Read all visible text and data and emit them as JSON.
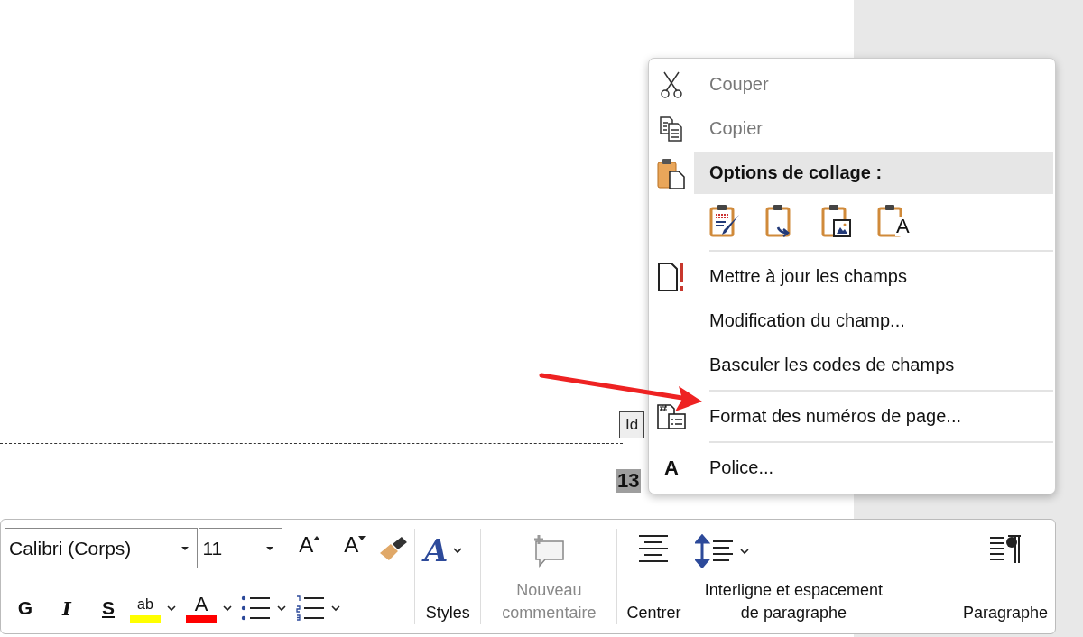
{
  "document": {
    "tab_label": "Id",
    "page_number": "13"
  },
  "context_menu": {
    "items": [
      {
        "kind": "command",
        "label": "Couper",
        "disabled": true,
        "highlighted": false
      },
      {
        "kind": "command",
        "label": "Copier",
        "disabled": true,
        "highlighted": false
      },
      {
        "kind": "header",
        "label": "Options de collage :",
        "highlighted": true
      },
      {
        "kind": "paste_options",
        "options": [
          {
            "kind": "keep_source"
          },
          {
            "kind": "merge"
          },
          {
            "kind": "picture"
          },
          {
            "kind": "text_only",
            "glyph": "A"
          }
        ]
      },
      {
        "kind": "separator"
      },
      {
        "kind": "command",
        "label": "Mettre à jour les champs",
        "disabled": false,
        "highlighted": false
      },
      {
        "kind": "command",
        "label": "Modification du champ...",
        "disabled": false,
        "highlighted": false
      },
      {
        "kind": "command",
        "label": "Basculer les codes de champs",
        "disabled": false,
        "highlighted": false
      },
      {
        "kind": "separator"
      },
      {
        "kind": "command",
        "label": "Format des numéros de page...",
        "disabled": false,
        "highlighted": false
      },
      {
        "kind": "separator"
      },
      {
        "kind": "command",
        "label": "Police...",
        "icon_glyph": "A",
        "disabled": false,
        "highlighted": false
      }
    ]
  },
  "mini_toolbar": {
    "font_field": {
      "value": "Calibri (Corps)"
    },
    "size_field": {
      "value": "11"
    },
    "font_size_buttons": [
      {
        "glyph": "A"
      },
      {
        "glyph": "A"
      }
    ],
    "format_buttons": [
      {
        "label": "G"
      },
      {
        "label": "I"
      },
      {
        "label": "S"
      }
    ],
    "highlight": {
      "glyph": "ab",
      "color": "#ffff00"
    },
    "font_color": {
      "glyph": "A",
      "color": "#ff0000"
    },
    "big_buttons": [
      {
        "label": "Styles",
        "glyph": "A",
        "disabled": false
      },
      {
        "label": "Nouveau commentaire",
        "disabled": true
      },
      {
        "label": "Centrer",
        "disabled": false
      },
      {
        "label": "Interligne et espacement de paragraphe",
        "disabled": false
      },
      {
        "label": "Paragraphe",
        "disabled": false
      }
    ]
  }
}
